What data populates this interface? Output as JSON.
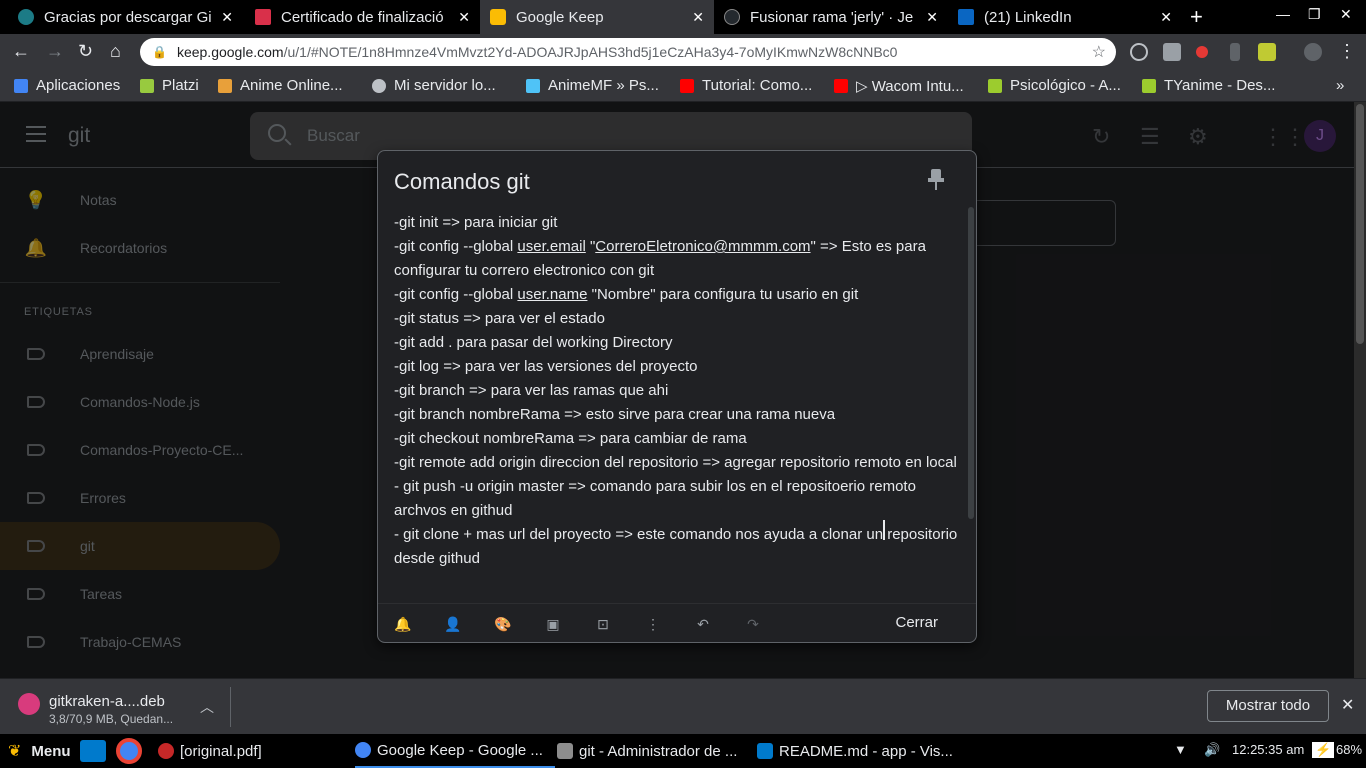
{
  "browser": {
    "tabs": [
      {
        "title": "Gracias por descargar Gi",
        "icon": "gitkraken-favicon",
        "color": "#1c7b86",
        "active": false
      },
      {
        "title": "Certificado de finalizació",
        "icon": "udemy-favicon",
        "color": "#d9304a",
        "active": false
      },
      {
        "title": "Google Keep",
        "icon": "google-keep-favicon",
        "color": "#fbbc04",
        "active": true
      },
      {
        "title": "Fusionar rama 'jerly' · Je",
        "icon": "github-favicon",
        "color": "#24292e",
        "active": false
      },
      {
        "title": "(21) LinkedIn",
        "icon": "linkedin-favicon",
        "color": "#0a66c2",
        "active": false
      }
    ],
    "url_host": "keep.google.com",
    "url_path": "/u/1/#NOTE/1n8Hmnze4VmMvzt2Yd-ADOAJRJpAHS3hd5j1eCzAHa3y4-7oMyIKmwNzW8cNNBc0",
    "bookmarks": [
      {
        "label": "Aplicaciones",
        "icon": "apps-grid-icon",
        "color": "#4285f4"
      },
      {
        "label": "Platzi",
        "icon": "platzi-icon",
        "color": "#98ca3f"
      },
      {
        "label": "Anime Online...",
        "icon": "anime-online-icon",
        "color": "#e8a03a"
      },
      {
        "label": "Mi servidor lo...",
        "icon": "globe-icon",
        "color": "#bdc1c6"
      },
      {
        "label": "AnimeMF » Ps...",
        "icon": "animemf-icon",
        "color": "#4fc3f7"
      },
      {
        "label": "Tutorial: Como...",
        "icon": "youtube-icon",
        "color": "#ff0000"
      },
      {
        "label": "▷ Wacom Intu...",
        "icon": "youtube-icon",
        "color": "#ff0000"
      },
      {
        "label": "Psicológico - A...",
        "icon": "tyanime-icon",
        "color": "#9ccc2e"
      },
      {
        "label": "TYanime - Des...",
        "icon": "tyanime-icon",
        "color": "#9ccc2e"
      }
    ]
  },
  "keep": {
    "app_title": "git",
    "search_placeholder": "Buscar",
    "avatar_letter": "J",
    "nav": [
      {
        "label": "Notas",
        "icon": "lightbulb-icon"
      },
      {
        "label": "Recordatorios",
        "icon": "bell-icon"
      }
    ],
    "labels_heading": "ETIQUETAS",
    "labels": [
      {
        "label": "Aprendisaje",
        "active": false
      },
      {
        "label": "Comandos-Node.js",
        "active": false
      },
      {
        "label": "Comandos-Proyecto-CE...",
        "active": false
      },
      {
        "label": "Errores",
        "active": false
      },
      {
        "label": "git",
        "active": true
      },
      {
        "label": "Tareas",
        "active": false
      },
      {
        "label": "Trabajo-CEMAS",
        "active": false
      }
    ]
  },
  "note": {
    "title": "Comandos git",
    "lines": [
      "-git init => para iniciar git",
      "-git config --global <u>user.email</u> \"<u>CorreroEletronico@mmmm.com</u>\" => Esto es para configurar tu correro electronico con git",
      "-git config --global <u>user.name</u> \"Nombre\" para configura tu usario en git",
      "-git status => para ver el estado",
      "-git add . para pasar  del working Directory",
      "-git log => para ver las versiones del proyecto",
      "-git branch => para ver las ramas que ahi",
      "-git branch nombreRama => esto sirve para crear una rama nueva",
      "-git checkout nombreRama =>  para cambiar de rama",
      "-git  remote add origin direccion del repositorio => agregar repositorio remoto en  local",
      "- git push -u origin master => comando para subir los en el repositoerio remoto archvos en githud",
      "- git clone + mas url del proyecto  => este comando nos ayuda a clonar un repositorio desde githud"
    ],
    "close_label": "Cerrar"
  },
  "downloads": {
    "file_name": "gitkraken-a....deb",
    "status": "3,8/70,9 MB, Quedan...",
    "show_all": "Mostrar todo"
  },
  "taskbar": {
    "menu_label": "Menu",
    "windows": [
      {
        "label": "[original.pdf]",
        "icon": "pdf-viewer-icon",
        "color": "#c62828",
        "active": false
      },
      {
        "label": "Google Keep - Google ...",
        "icon": "chrome-icon",
        "color": "#4285f4",
        "active": true
      },
      {
        "label": "git - Administrador de ...",
        "icon": "folder-icon",
        "color": "#8d8d8d",
        "active": false
      },
      {
        "label": "README.md - app - Vis...",
        "icon": "vscode-icon",
        "color": "#007acc",
        "active": false
      }
    ],
    "clock": "12:25:35 am",
    "battery": "68%"
  }
}
